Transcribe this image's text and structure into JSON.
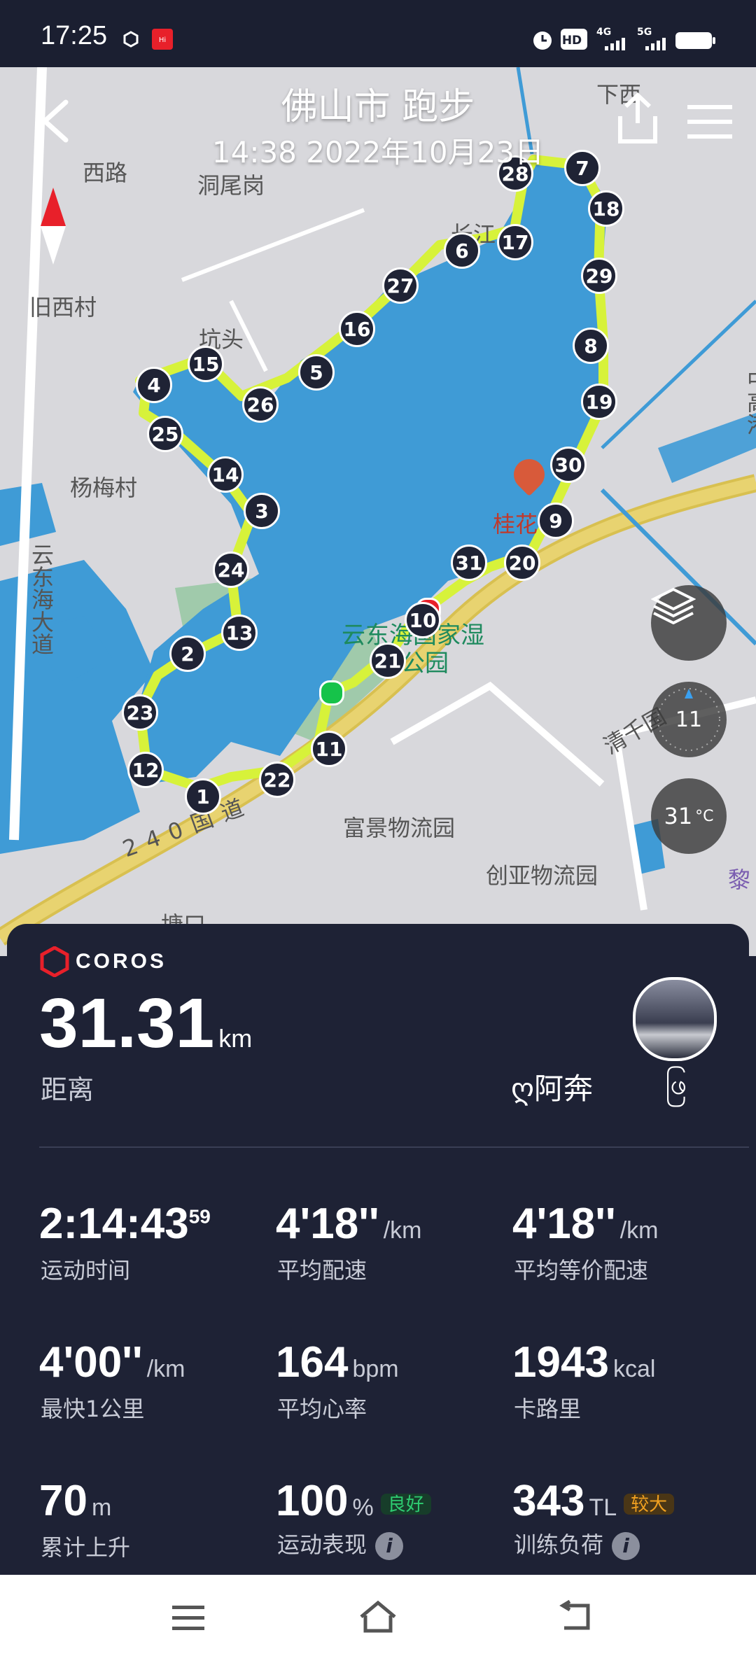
{
  "status_bar": {
    "time": "17:25",
    "icons": [
      "vpn-icon",
      "app-notification-icon",
      "alarm-icon",
      "hd-icon",
      "signal-4g-icon",
      "signal-5g-icon",
      "battery-icon"
    ],
    "signal_labels": [
      "4G",
      "5G"
    ],
    "hd_label": "HD"
  },
  "header": {
    "title": "佛山市 跑步",
    "datetime": "14:38 2022年10月23日"
  },
  "map": {
    "labels": [
      "西路",
      "洞尾岗",
      "下西",
      "旧西村",
      "坑头",
      "长江",
      "杨梅村",
      "桂花",
      "云东海大道",
      "云东海国家湿地公园",
      "清千国",
      "富景物流园",
      "创亚物流园",
      "240国道",
      "黎",
      "中高港",
      "塘口"
    ],
    "km_markers": [
      "1",
      "2",
      "3",
      "4",
      "5",
      "6",
      "7",
      "8",
      "9",
      "10",
      "11",
      "12",
      "13",
      "14",
      "15",
      "16",
      "17",
      "18",
      "19",
      "20",
      "21",
      "22",
      "23",
      "24",
      "25",
      "26",
      "27",
      "28",
      "29",
      "30",
      "31"
    ],
    "compass_heading": "11",
    "temperature": "31",
    "temperature_unit": "°C"
  },
  "panel": {
    "brand": "COROS",
    "distance_value": "31.31",
    "distance_unit": "km",
    "distance_label": "距离",
    "user_name": "ღ阿奔",
    "user_suffix": "ဖြ",
    "stats": [
      {
        "value": "2:14:43",
        "sup": "59",
        "unit": "",
        "label": "运动时间"
      },
      {
        "value": "4'18''",
        "unit": "/km",
        "label": "平均配速"
      },
      {
        "value": "4'18''",
        "unit": "/km",
        "label": "平均等价配速"
      },
      {
        "value": "4'00''",
        "unit": "/km",
        "label": "最快1公里"
      },
      {
        "value": "164",
        "unit": "bpm",
        "label": "平均心率"
      },
      {
        "value": "1943",
        "unit": "kcal",
        "label": "卡路里"
      },
      {
        "value": "70",
        "unit": "m",
        "label": "累计上升"
      },
      {
        "value": "100",
        "unit": "%",
        "label": "运动表现",
        "badge": "良好"
      },
      {
        "value": "343",
        "unit": "TL",
        "label": "训练负荷",
        "badge": "较大"
      }
    ],
    "info_glyph": "i"
  },
  "colors": {
    "panel_bg": "#1e2235",
    "route": "#d7f23a",
    "water": "#3f9bd6",
    "badge_good": "#2ecc71",
    "badge_high": "#f0a020"
  }
}
